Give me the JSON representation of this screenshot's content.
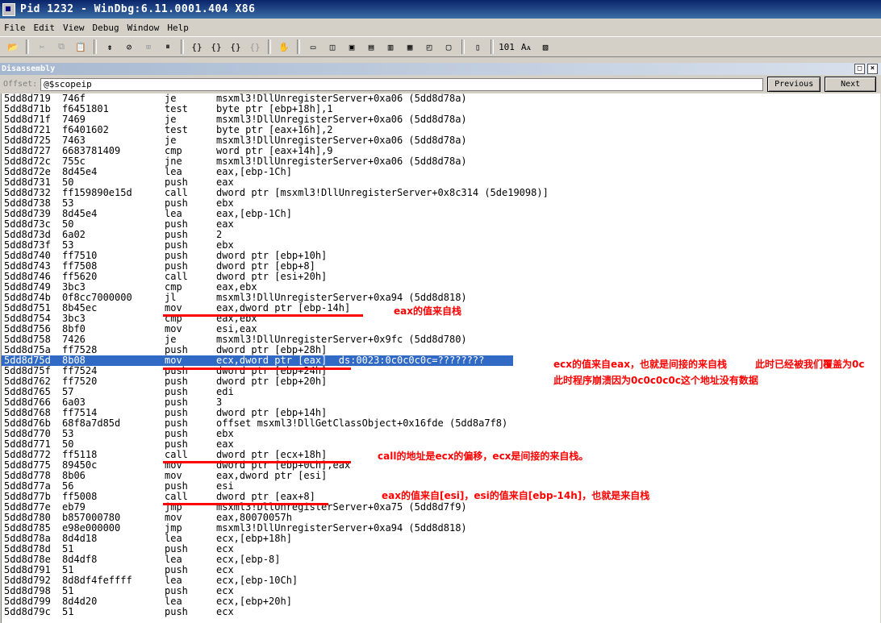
{
  "window": {
    "title": "Pid 1232 - WinDbg:6.11.0001.404 X86"
  },
  "menu": [
    "File",
    "Edit",
    "View",
    "Debug",
    "Window",
    "Help"
  ],
  "toolbar": {
    "icons": [
      "open-icon",
      "cut-icon",
      "copy-icon",
      "paste-icon",
      "restart-icon",
      "stop-debugging-icon",
      "detach-icon",
      "break-icon",
      "step-into-icon",
      "step-over-icon",
      "step-out-icon",
      "run-to-cursor-icon",
      "hand-icon",
      "command-window-icon",
      "watch-icon",
      "locals-icon",
      "registers-icon",
      "memory-icon",
      "call-stack-icon",
      "disassembly-icon",
      "scratch-pad-icon",
      "source-mode-icon",
      "binary-icon",
      "font-icon",
      "options-icon"
    ],
    "labels": [
      "📂",
      "✂",
      "⧉",
      "📋",
      "⇟",
      "⊘",
      "⌧",
      "⏸",
      "{}",
      "{}",
      "{}",
      "{}",
      "✋",
      "▭",
      "◫",
      "▣",
      "▤",
      "▥",
      "▦",
      "◰",
      "▢",
      "▯",
      "101",
      "Aᴀ",
      "▧"
    ]
  },
  "pane": {
    "title": "Disassembly"
  },
  "offset": {
    "label": "Offset:",
    "value": "@$scopeip",
    "previous_label": "Previous",
    "next_label": "Next"
  },
  "lines": [
    {
      "addr": "5dd8d719",
      "bytes": "746f",
      "mnemonic": "je",
      "operands": "msxml3!DllUnregisterServer+0xa06 (5dd8d78a)"
    },
    {
      "addr": "5dd8d71b",
      "bytes": "f6451801",
      "mnemonic": "test",
      "operands": "byte ptr [ebp+18h],1"
    },
    {
      "addr": "5dd8d71f",
      "bytes": "7469",
      "mnemonic": "je",
      "operands": "msxml3!DllUnregisterServer+0xa06 (5dd8d78a)"
    },
    {
      "addr": "5dd8d721",
      "bytes": "f6401602",
      "mnemonic": "test",
      "operands": "byte ptr [eax+16h],2"
    },
    {
      "addr": "5dd8d725",
      "bytes": "7463",
      "mnemonic": "je",
      "operands": "msxml3!DllUnregisterServer+0xa06 (5dd8d78a)"
    },
    {
      "addr": "5dd8d727",
      "bytes": "6683781409",
      "mnemonic": "cmp",
      "operands": "word ptr [eax+14h],9"
    },
    {
      "addr": "5dd8d72c",
      "bytes": "755c",
      "mnemonic": "jne",
      "operands": "msxml3!DllUnregisterServer+0xa06 (5dd8d78a)"
    },
    {
      "addr": "5dd8d72e",
      "bytes": "8d45e4",
      "mnemonic": "lea",
      "operands": "eax,[ebp-1Ch]"
    },
    {
      "addr": "5dd8d731",
      "bytes": "50",
      "mnemonic": "push",
      "operands": "eax"
    },
    {
      "addr": "5dd8d732",
      "bytes": "ff159890e15d",
      "mnemonic": "call",
      "operands": "dword ptr [msxml3!DllUnregisterServer+0x8c314 (5de19098)]"
    },
    {
      "addr": "5dd8d738",
      "bytes": "53",
      "mnemonic": "push",
      "operands": "ebx"
    },
    {
      "addr": "5dd8d739",
      "bytes": "8d45e4",
      "mnemonic": "lea",
      "operands": "eax,[ebp-1Ch]"
    },
    {
      "addr": "5dd8d73c",
      "bytes": "50",
      "mnemonic": "push",
      "operands": "eax"
    },
    {
      "addr": "5dd8d73d",
      "bytes": "6a02",
      "mnemonic": "push",
      "operands": "2"
    },
    {
      "addr": "5dd8d73f",
      "bytes": "53",
      "mnemonic": "push",
      "operands": "ebx"
    },
    {
      "addr": "5dd8d740",
      "bytes": "ff7510",
      "mnemonic": "push",
      "operands": "dword ptr [ebp+10h]"
    },
    {
      "addr": "5dd8d743",
      "bytes": "ff7508",
      "mnemonic": "push",
      "operands": "dword ptr [ebp+8]"
    },
    {
      "addr": "5dd8d746",
      "bytes": "ff5620",
      "mnemonic": "call",
      "operands": "dword ptr [esi+20h]"
    },
    {
      "addr": "5dd8d749",
      "bytes": "3bc3",
      "mnemonic": "cmp",
      "operands": "eax,ebx"
    },
    {
      "addr": "5dd8d74b",
      "bytes": "0f8cc7000000",
      "mnemonic": "jl",
      "operands": "msxml3!DllUnregisterServer+0xa94 (5dd8d818)"
    },
    {
      "addr": "5dd8d751",
      "bytes": "8b45ec",
      "mnemonic": "mov",
      "operands": "eax,dword ptr [ebp-14h]"
    },
    {
      "addr": "5dd8d754",
      "bytes": "3bc3",
      "mnemonic": "cmp",
      "operands": "eax,ebx"
    },
    {
      "addr": "5dd8d756",
      "bytes": "8bf0",
      "mnemonic": "mov",
      "operands": "esi,eax"
    },
    {
      "addr": "5dd8d758",
      "bytes": "7426",
      "mnemonic": "je",
      "operands": "msxml3!DllUnregisterServer+0x9fc (5dd8d780)"
    },
    {
      "addr": "5dd8d75a",
      "bytes": "ff7528",
      "mnemonic": "push",
      "operands": "dword ptr [ebp+28h]"
    },
    {
      "addr": "5dd8d75d",
      "bytes": "8b08",
      "mnemonic": "mov",
      "operands": "ecx,dword ptr [eax]  ds:0023:0c0c0c0c=????????"
    },
    {
      "addr": "5dd8d75f",
      "bytes": "ff7524",
      "mnemonic": "push",
      "operands": "dword ptr [ebp+24h]"
    },
    {
      "addr": "5dd8d762",
      "bytes": "ff7520",
      "mnemonic": "push",
      "operands": "dword ptr [ebp+20h]"
    },
    {
      "addr": "5dd8d765",
      "bytes": "57",
      "mnemonic": "push",
      "operands": "edi"
    },
    {
      "addr": "5dd8d766",
      "bytes": "6a03",
      "mnemonic": "push",
      "operands": "3"
    },
    {
      "addr": "5dd8d768",
      "bytes": "ff7514",
      "mnemonic": "push",
      "operands": "dword ptr [ebp+14h]"
    },
    {
      "addr": "5dd8d76b",
      "bytes": "68f8a7d85d",
      "mnemonic": "push",
      "operands": "offset msxml3!DllGetClassObject+0x16fde (5dd8a7f8)"
    },
    {
      "addr": "5dd8d770",
      "bytes": "53",
      "mnemonic": "push",
      "operands": "ebx"
    },
    {
      "addr": "5dd8d771",
      "bytes": "50",
      "mnemonic": "push",
      "operands": "eax"
    },
    {
      "addr": "5dd8d772",
      "bytes": "ff5118",
      "mnemonic": "call",
      "operands": "dword ptr [ecx+18h]"
    },
    {
      "addr": "5dd8d775",
      "bytes": "89450c",
      "mnemonic": "mov",
      "operands": "dword ptr [ebp+0Ch],eax"
    },
    {
      "addr": "5dd8d778",
      "bytes": "8b06",
      "mnemonic": "mov",
      "operands": "eax,dword ptr [esi]"
    },
    {
      "addr": "5dd8d77a",
      "bytes": "56",
      "mnemonic": "push",
      "operands": "esi"
    },
    {
      "addr": "5dd8d77b",
      "bytes": "ff5008",
      "mnemonic": "call",
      "operands": "dword ptr [eax+8]"
    },
    {
      "addr": "5dd8d77e",
      "bytes": "eb79",
      "mnemonic": "jmp",
      "operands": "msxml3!DllUnregisterServer+0xa75 (5dd8d7f9)"
    },
    {
      "addr": "5dd8d780",
      "bytes": "b857000780",
      "mnemonic": "mov",
      "operands": "eax,80070057h"
    },
    {
      "addr": "5dd8d785",
      "bytes": "e98e000000",
      "mnemonic": "jmp",
      "operands": "msxml3!DllUnregisterServer+0xa94 (5dd8d818)"
    },
    {
      "addr": "5dd8d78a",
      "bytes": "8d4d18",
      "mnemonic": "lea",
      "operands": "ecx,[ebp+18h]"
    },
    {
      "addr": "5dd8d78d",
      "bytes": "51",
      "mnemonic": "push",
      "operands": "ecx"
    },
    {
      "addr": "5dd8d78e",
      "bytes": "8d4df8",
      "mnemonic": "lea",
      "operands": "ecx,[ebp-8]"
    },
    {
      "addr": "5dd8d791",
      "bytes": "51",
      "mnemonic": "push",
      "operands": "ecx"
    },
    {
      "addr": "5dd8d792",
      "bytes": "8d8df4feffff",
      "mnemonic": "lea",
      "operands": "ecx,[ebp-10Ch]"
    },
    {
      "addr": "5dd8d798",
      "bytes": "51",
      "mnemonic": "push",
      "operands": "ecx"
    },
    {
      "addr": "5dd8d799",
      "bytes": "8d4d20",
      "mnemonic": "lea",
      "operands": "ecx,[ebp+20h]"
    },
    {
      "addr": "5dd8d79c",
      "bytes": "51",
      "mnemonic": "push",
      "operands": "ecx"
    }
  ],
  "selected_index": 25,
  "annotations": [
    {
      "text": "eax的值来自栈"
    },
    {
      "text": "ecx的值来自eax，也就是间接的来自栈"
    },
    {
      "text": "此时已经被我们覆盖为0c"
    },
    {
      "text": "此时程序崩溃因为0c0c0c0c这个地址没有数据"
    },
    {
      "text": "call的地址是ecx的偏移，ecx是间接的来自栈。"
    },
    {
      "text": "eax的值来自[esi]，esi的值来自[ebp-14h]，也就是来自栈"
    }
  ],
  "colors": {
    "selection": "#316ac5",
    "annotation": "#ff0000"
  }
}
